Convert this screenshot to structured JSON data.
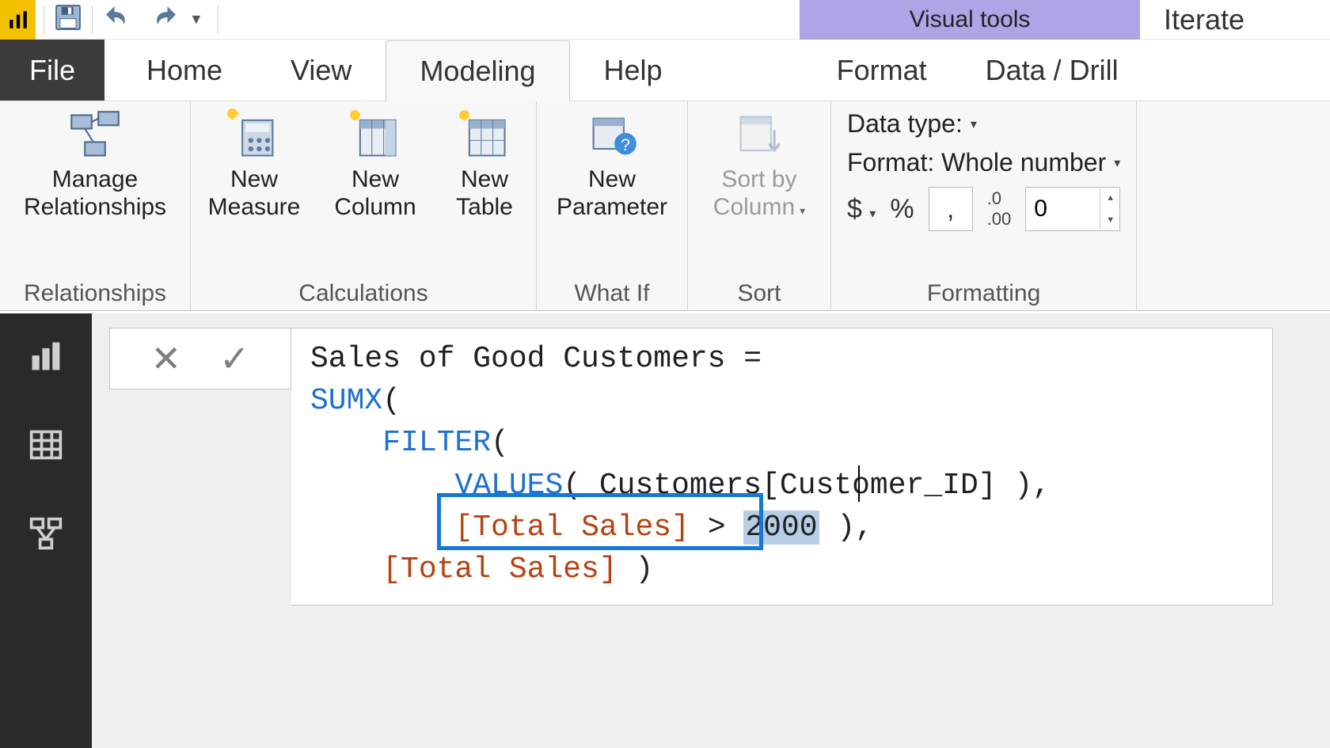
{
  "qat": {
    "context_tab": "Visual tools",
    "title_fragment": "Iterate"
  },
  "tabs": {
    "file": "File",
    "home": "Home",
    "view": "View",
    "modeling": "Modeling",
    "help": "Help",
    "format": "Format",
    "data_drill": "Data / Drill"
  },
  "ribbon": {
    "relationships": {
      "manage": "Manage\nRelationships",
      "group": "Relationships"
    },
    "calculations": {
      "measure": "New\nMeasure",
      "column": "New\nColumn",
      "table": "New\nTable",
      "group": "Calculations"
    },
    "whatif": {
      "param": "New\nParameter",
      "group": "What If"
    },
    "sort": {
      "btn": "Sort by\nColumn",
      "group": "Sort"
    },
    "fmt": {
      "datatype": "Data type:",
      "format_label": "Format: Whole number",
      "currency": "$",
      "percent": "%",
      "comma": ",",
      "decimals_icon": ".00",
      "decimals_value": "0",
      "group": "Formatting"
    }
  },
  "formula": {
    "line1": "Sales of Good Customers =",
    "fn_sumx": "SUMX",
    "paren_open1": "(",
    "fn_filter": "FILTER",
    "paren_open2": "(",
    "fn_values": "VALUES",
    "values_arg": "( Customers[Customer_ID] ),",
    "col_total_sales": "[Total Sales]",
    "gt": " > ",
    "threshold": "2000",
    "tail_filter_close": " ),",
    "final_paren": " )"
  },
  "background_text": "Iter"
}
